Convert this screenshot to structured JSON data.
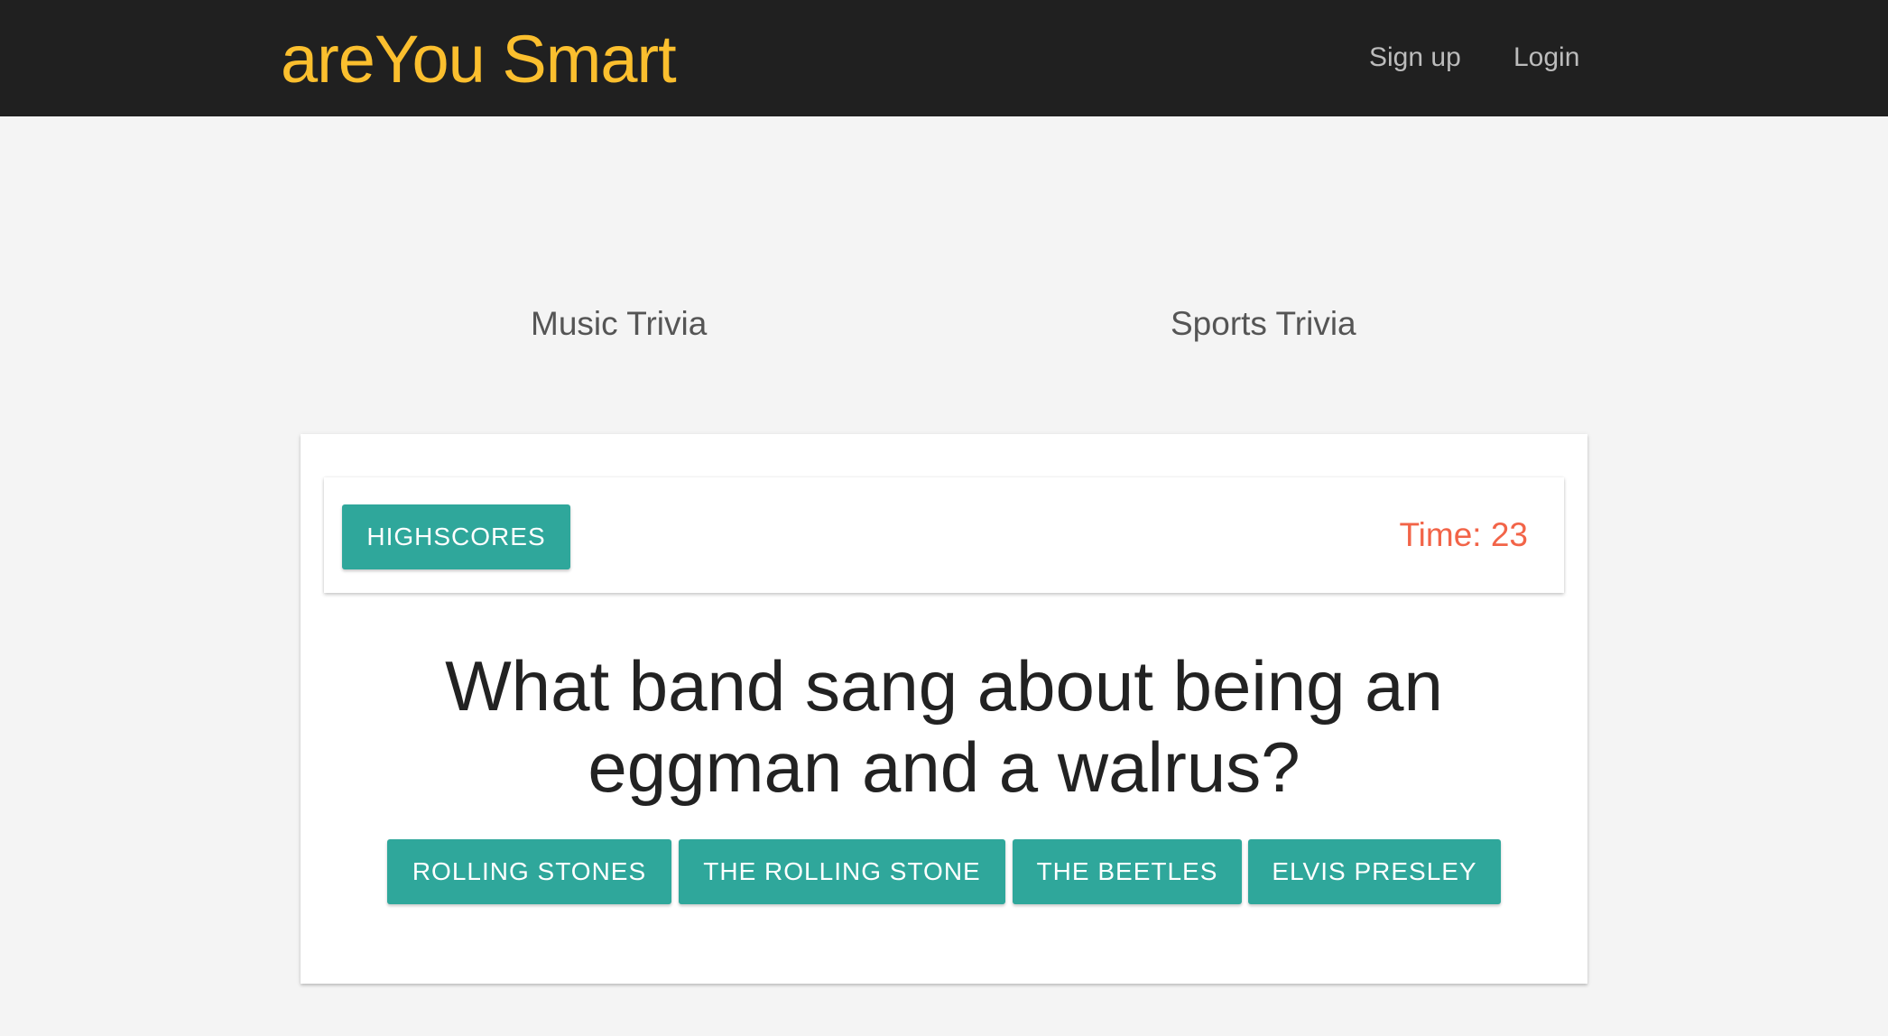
{
  "navbar": {
    "brand": "areYou Smart",
    "links": [
      {
        "label": "Sign up"
      },
      {
        "label": "Login"
      }
    ]
  },
  "categories": [
    {
      "label": "Music Trivia"
    },
    {
      "label": "Sports Trivia"
    }
  ],
  "quiz": {
    "highscores_label": "HIGHSCORES",
    "timer_text": "Time: 23",
    "question": "What band sang about being an eggman and a walrus?",
    "answers": [
      {
        "label": "ROLLING STONES"
      },
      {
        "label": "THE ROLLING STONE"
      },
      {
        "label": "THE BEETLES"
      },
      {
        "label": "ELVIS PRESLEY"
      }
    ]
  },
  "colors": {
    "navbar_bg": "#202020",
    "brand": "#fbbf2e",
    "accent_teal": "#2fa79b",
    "timer": "#f26448",
    "page_bg": "#f4f4f4"
  }
}
